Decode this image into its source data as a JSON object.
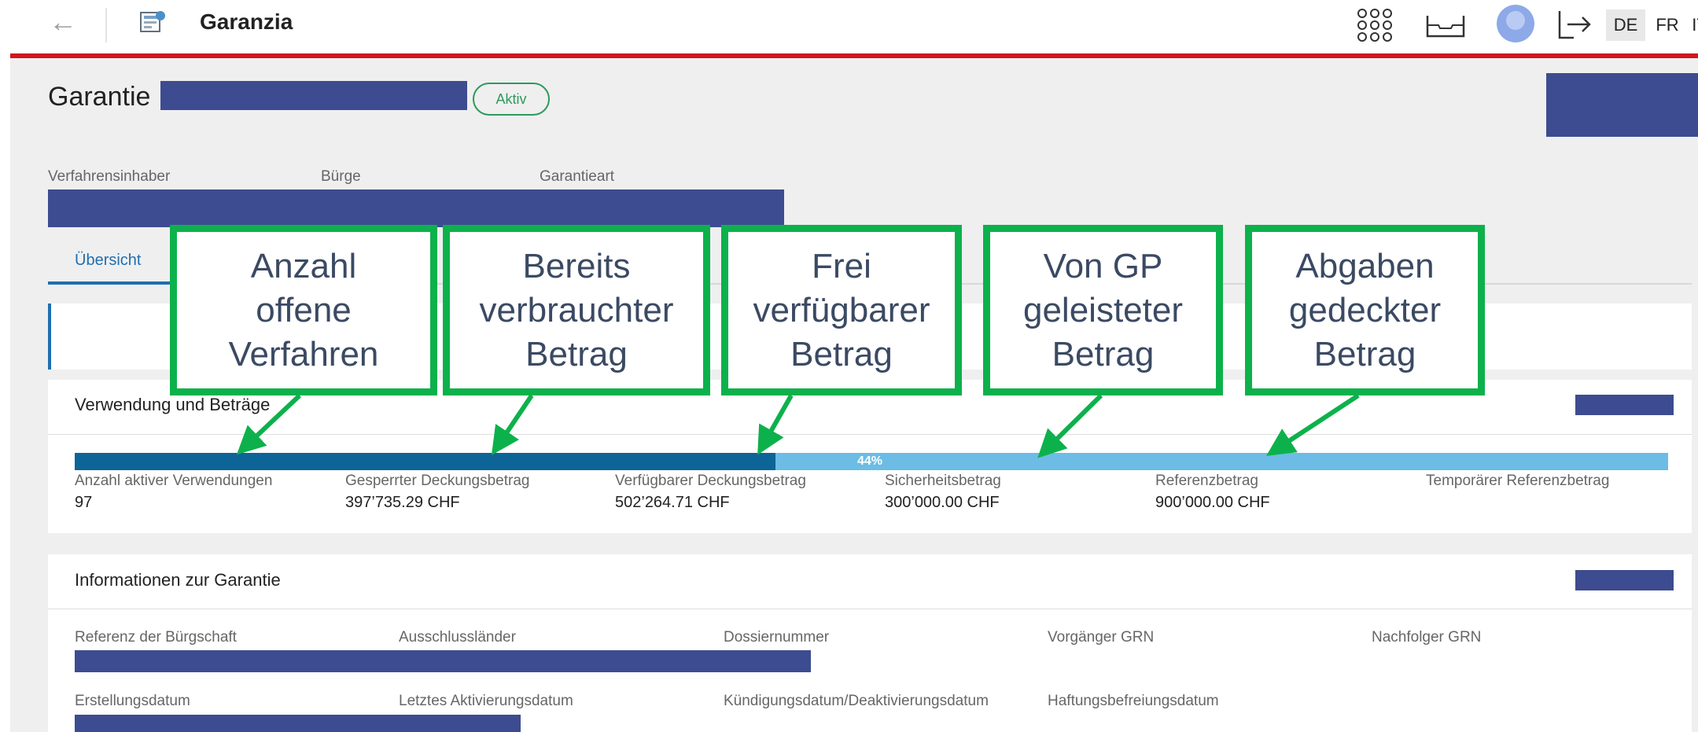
{
  "header": {
    "app_title": "Garanzia",
    "languages": [
      "DE",
      "FR",
      "IT"
    ],
    "active_language": "DE"
  },
  "page": {
    "title": "Garantie",
    "status_badge": "Aktiv"
  },
  "meta": {
    "labels": [
      "Verfahrensinhaber",
      "Bürge",
      "Garantieart"
    ]
  },
  "tabs": {
    "active": "Übersicht"
  },
  "usage_card": {
    "title": "Verwendung und Beträge",
    "progress_percent_label": "44%",
    "progress_fraction": 0.44,
    "fields": [
      {
        "label": "Anzahl aktiver Verwendungen",
        "value": "97"
      },
      {
        "label": "Gesperrter Deckungsbetrag",
        "value": "397’735.29 CHF"
      },
      {
        "label": "Verfügbarer Deckungsbetrag",
        "value": "502’264.71 CHF"
      },
      {
        "label": "Sicherheitsbetrag",
        "value": "300’000.00 CHF"
      },
      {
        "label": "Referenzbetrag",
        "value": "900’000.00 CHF"
      },
      {
        "label": "Temporärer Referenzbetrag",
        "value": ""
      }
    ]
  },
  "info_card": {
    "title": "Informationen zur Garantie",
    "row1": [
      "Referenz der Bürgschaft",
      "Ausschlussländer",
      "Dossiernummer",
      "Vorgänger GRN",
      "Nachfolger GRN"
    ],
    "row2": [
      "Erstellungsdatum",
      "Letztes Aktivierungsdatum",
      "Kündigungsdatum/Deaktivierungsdatum",
      "Haftungsbefreiungsdatum"
    ]
  },
  "callouts": [
    [
      "Anzahl",
      "offene",
      "Verfahren"
    ],
    [
      "Bereits",
      "verbrauchter",
      "Betrag"
    ],
    [
      "Frei",
      "verfügbarer",
      "Betrag"
    ],
    [
      "Von GP",
      "geleisteter",
      "Betrag"
    ],
    [
      "Abgaben",
      "gedeckter",
      "Betrag"
    ]
  ],
  "colors": {
    "accent_red": "#d2141e",
    "redaction": "#3d4c90",
    "bar_dark": "#0d6497",
    "bar_light": "#6cbce5",
    "callout_green": "#0db14b"
  }
}
